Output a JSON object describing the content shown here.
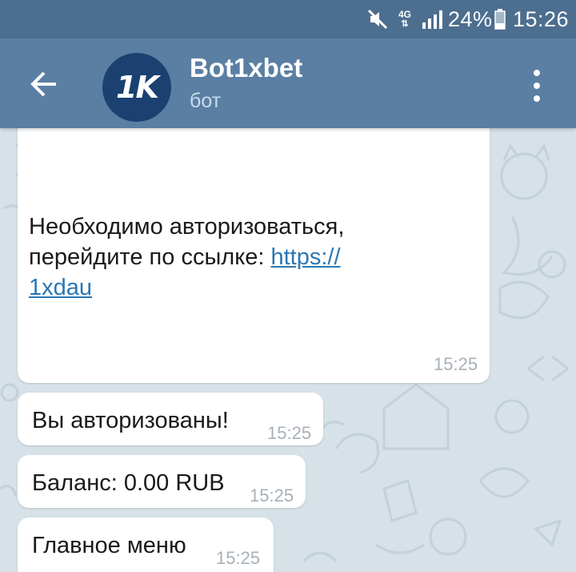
{
  "status_bar": {
    "network": "4G",
    "battery": "24%",
    "time": "15:26",
    "icons": [
      "mute-icon",
      "network-4g-icon",
      "signal-icon",
      "battery-icon"
    ]
  },
  "header": {
    "title": "Bot1xbet",
    "subtitle": "бот",
    "avatar_text": "1K",
    "avatar_color": "#1a4170",
    "bar_color": "#5a7fa3",
    "status_color": "#4c6e8f"
  },
  "messages": [
    {
      "text_line1": "Необходимо авторизоваться,",
      "text_line2_prefix": "перейдите по ссылке: ",
      "link_part1": "https://",
      "link_part2": "1xdau",
      "time": "15:25"
    },
    {
      "text": "Вы авторизованы!",
      "time": "15:25"
    },
    {
      "text": "Баланс: 0.00 RUB",
      "time": "15:25"
    },
    {
      "text": "Главное меню",
      "time": "15:25"
    }
  ],
  "colors": {
    "chat_background": "#d6e1e8",
    "link": "#2b77b3",
    "timestamp": "#a7b0b8"
  }
}
